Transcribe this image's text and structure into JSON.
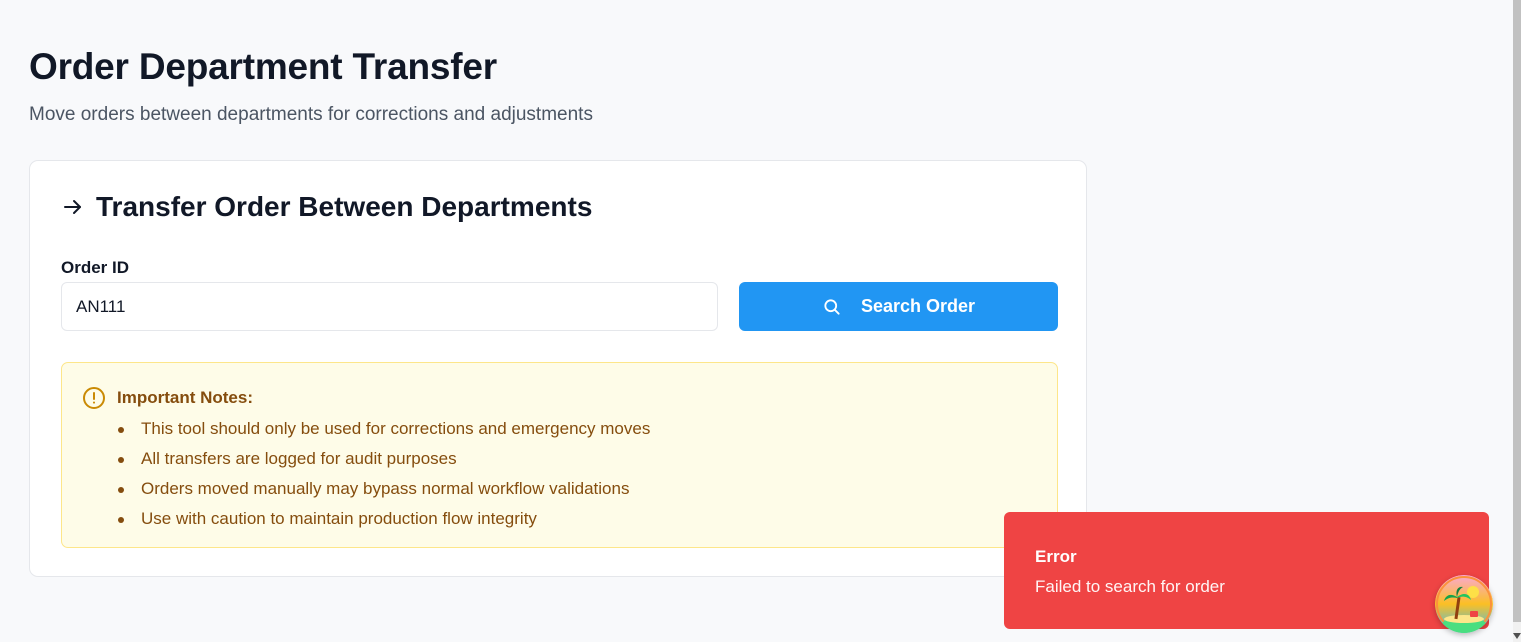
{
  "page": {
    "title": "Order Department Transfer",
    "subtitle": "Move orders between departments for corrections and adjustments"
  },
  "card": {
    "title": "Transfer Order Between Departments",
    "icon": "arrow-right-icon"
  },
  "form": {
    "order_id_label": "Order ID",
    "order_id_value": "AN111",
    "search_button_label": "Search Order",
    "search_icon": "search-icon"
  },
  "notes": {
    "icon": "alert-circle-icon",
    "title": "Important Notes:",
    "items": [
      "This tool should only be used for corrections and emergency moves",
      "All transfers are logged for audit purposes",
      "Orders moved manually may bypass normal workflow validations",
      "Use with caution to maintain production flow integrity"
    ]
  },
  "toast": {
    "title": "Error",
    "message": "Failed to search for order"
  },
  "colors": {
    "accent": "#2196f3",
    "error": "#ef4444",
    "warning_bg": "#fefce8",
    "warning_text": "#854d0e"
  }
}
